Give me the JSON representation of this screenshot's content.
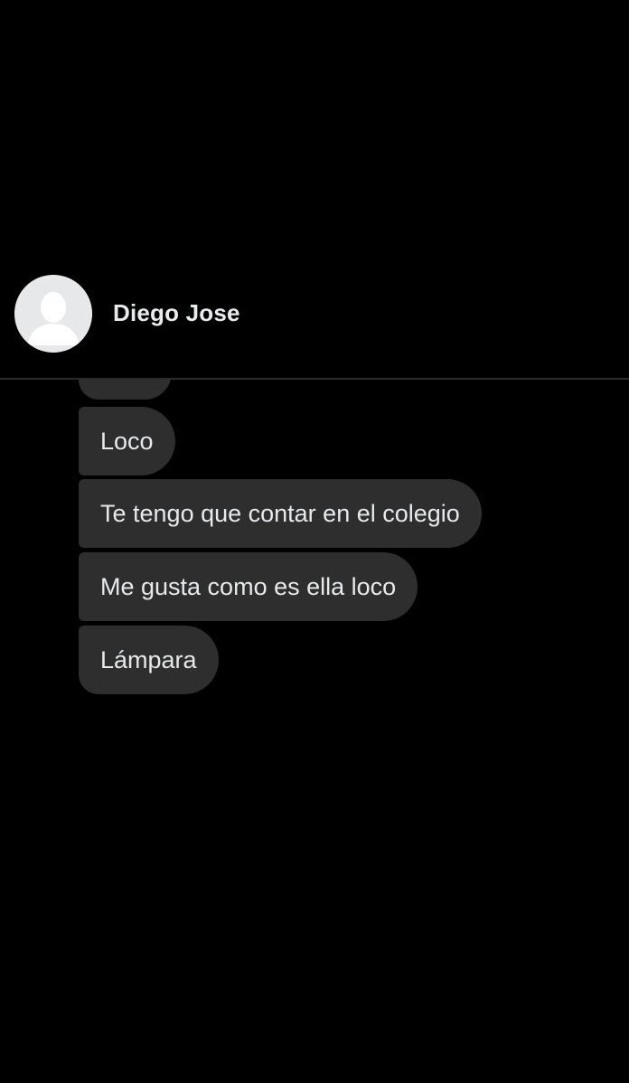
{
  "contact": {
    "name": "Diego Jose",
    "avatar_icon": "default-profile-silhouette-icon"
  },
  "messages": [
    {
      "text": "Loco"
    },
    {
      "text": "Te tengo que contar en el colegio"
    },
    {
      "text": "Me gusta como es ella loco"
    },
    {
      "text": "Lámpara"
    }
  ],
  "colors": {
    "background": "#000000",
    "bubble": "#2e2e2e",
    "text": "#e8e9eb",
    "avatar_bg": "#e6e8ea"
  }
}
